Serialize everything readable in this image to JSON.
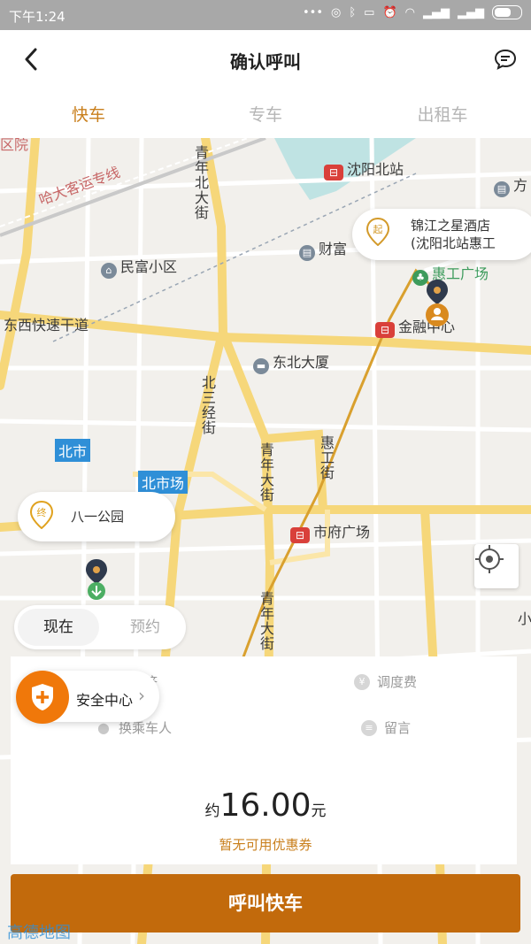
{
  "status_bar": {
    "time": "下午1:24",
    "icons": [
      "signal-dots-icon",
      "circle-icon",
      "bluetooth-icon",
      "vr-icon",
      "alarm-icon",
      "wifi-icon",
      "signal-icon",
      "signal-icon-2",
      "battery-icon"
    ]
  },
  "nav": {
    "title": "确认呼叫",
    "back_icon": "back-chevron-icon",
    "message_icon": "message-bubble-icon"
  },
  "tabs": [
    {
      "label": "快车",
      "active": true
    },
    {
      "label": "专车",
      "active": false
    },
    {
      "label": "出租车",
      "active": false
    }
  ],
  "map": {
    "labels": {
      "shenyang_north": "沈阳北站",
      "harbin_dalian": "哈大客运专线",
      "minfu": "民富小区",
      "caifu": "财富",
      "huigong": "惠工广场",
      "jinrong": "金融中心",
      "dongxi": "东西快速干道",
      "dongbei": "东北大厦",
      "qingnian_north": "青年北大街",
      "beisanjing": "北三经街",
      "qingnian": "青年大街",
      "huigong_street": "惠工街",
      "beishi": "北市",
      "beishichang": "北市场",
      "shifu": "市府广场",
      "qingnian2": "青年大街",
      "edge_left": "区院",
      "edge_right": "方",
      "edge_bottom": "青年大街"
    },
    "start": {
      "badge": "起",
      "line1": "锦江之星酒店",
      "line2": "(沈阳北站惠工"
    },
    "end": {
      "badge": "终",
      "name": "八一公园"
    },
    "locate_icon": "crosshair-icon",
    "watermark": "高德地图"
  },
  "time_toggle": {
    "now": "现在",
    "book": "预约"
  },
  "panel": {
    "options": {
      "economy": "经济",
      "dispatch_fee": "调度费",
      "change_rider": "换乘车人",
      "message": "留言"
    },
    "safety_center": "安全中心",
    "price_prefix": "约",
    "price": "16.00",
    "price_suffix": "元",
    "coupon": "暂无可用优惠券"
  },
  "call_button": "呼叫快车",
  "colors": {
    "accent": "#c97f1c",
    "button": "#c26a0c",
    "safety": "#f0780a"
  }
}
